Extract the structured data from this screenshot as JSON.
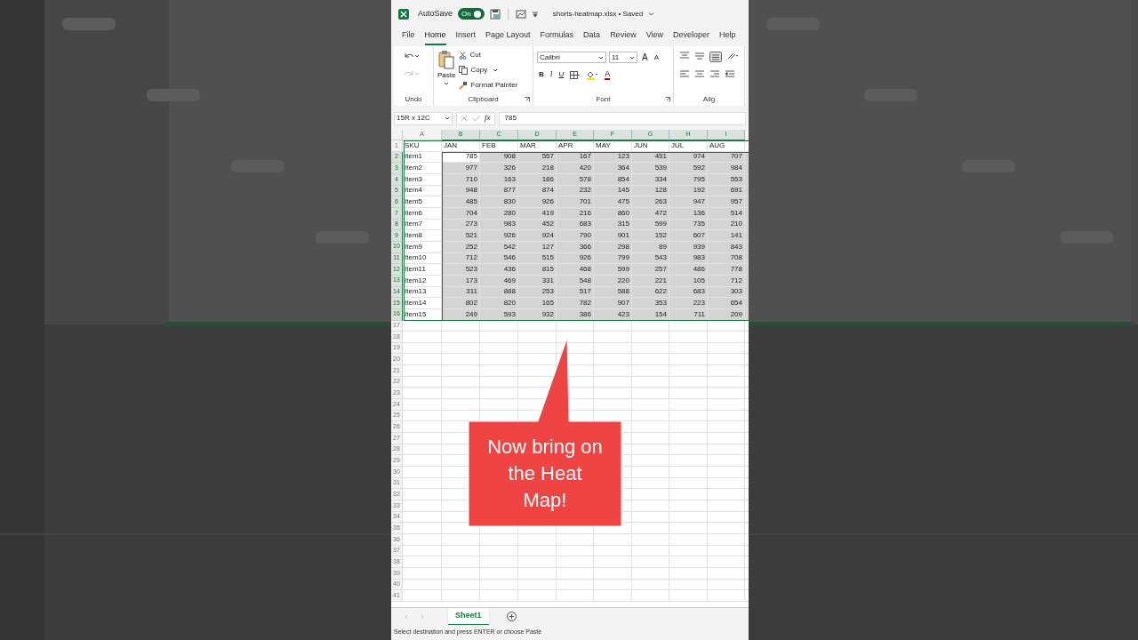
{
  "title_bar": {
    "autosave_label": "AutoSave",
    "autosave_toggle": {
      "label": "On",
      "on": true
    },
    "file_title": "shorts-heatmap.xlsx • Saved"
  },
  "tabs": [
    {
      "label": "File",
      "selected": false
    },
    {
      "label": "Home",
      "selected": true
    },
    {
      "label": "Insert",
      "selected": false
    },
    {
      "label": "Page Layout",
      "selected": false
    },
    {
      "label": "Formulas",
      "selected": false
    },
    {
      "label": "Data",
      "selected": false
    },
    {
      "label": "Review",
      "selected": false
    },
    {
      "label": "View",
      "selected": false
    },
    {
      "label": "Developer",
      "selected": false
    },
    {
      "label": "Help",
      "selected": false
    }
  ],
  "ribbon": {
    "undo": {
      "label": "Undo"
    },
    "clipboard": {
      "paste": "Paste",
      "cut": "Cut",
      "copy": "Copy",
      "format_painter": "Format Painter",
      "label": "Clipboard"
    },
    "font": {
      "font_name": "Calibri",
      "font_size": "11",
      "grow": "A",
      "shrink": "A",
      "bold": "B",
      "italic": "I",
      "underline": "U",
      "font_color": "A",
      "label": "Font"
    },
    "alignment": {
      "label": "Alig"
    }
  },
  "formula_bar": {
    "name_box": "15R x 12C",
    "fx": "fx",
    "value": "785"
  },
  "sheet": {
    "column_letters": [
      "A",
      "B",
      "C",
      "D",
      "E",
      "F",
      "G",
      "H",
      "I"
    ],
    "header": [
      "SKU",
      "JAN",
      "FEB",
      "MAR",
      "APR",
      "MAY",
      "JUN",
      "JUL",
      "AUG"
    ],
    "rows": [
      {
        "sku": "Item1",
        "selected": true,
        "active": true,
        "values": [
          "785",
          "908",
          "557",
          "167",
          "123",
          "451",
          "974",
          "707"
        ]
      },
      {
        "sku": "Item2",
        "selected": true,
        "active": false,
        "values": [
          "977",
          "326",
          "218",
          "420",
          "364",
          "539",
          "592",
          "984"
        ]
      },
      {
        "sku": "Item3",
        "selected": true,
        "active": false,
        "values": [
          "710",
          "163",
          "186",
          "578",
          "854",
          "334",
          "795",
          "553"
        ]
      },
      {
        "sku": "Item4",
        "selected": true,
        "active": false,
        "values": [
          "948",
          "877",
          "874",
          "232",
          "145",
          "128",
          "192",
          "691"
        ]
      },
      {
        "sku": "Item5",
        "selected": true,
        "active": false,
        "values": [
          "485",
          "830",
          "926",
          "701",
          "475",
          "263",
          "947",
          "957"
        ]
      },
      {
        "sku": "Item6",
        "selected": true,
        "active": false,
        "values": [
          "704",
          "280",
          "419",
          "216",
          "860",
          "472",
          "136",
          "514"
        ]
      },
      {
        "sku": "Item7",
        "selected": true,
        "active": false,
        "values": [
          "273",
          "983",
          "452",
          "683",
          "315",
          "599",
          "735",
          "210"
        ]
      },
      {
        "sku": "Item8",
        "selected": true,
        "active": false,
        "values": [
          "521",
          "926",
          "924",
          "790",
          "901",
          "152",
          "607",
          "141"
        ]
      },
      {
        "sku": "Item9",
        "selected": true,
        "active": false,
        "values": [
          "252",
          "542",
          "127",
          "366",
          "298",
          "89",
          "939",
          "843"
        ]
      },
      {
        "sku": "Item10",
        "selected": true,
        "active": false,
        "values": [
          "712",
          "546",
          "515",
          "926",
          "799",
          "543",
          "983",
          "708"
        ]
      },
      {
        "sku": "Item11",
        "selected": true,
        "active": false,
        "values": [
          "523",
          "436",
          "815",
          "468",
          "599",
          "257",
          "486",
          "778"
        ]
      },
      {
        "sku": "Item12",
        "selected": true,
        "active": false,
        "values": [
          "173",
          "469",
          "331",
          "548",
          "220",
          "221",
          "105",
          "712"
        ]
      },
      {
        "sku": "Item13",
        "selected": true,
        "active": false,
        "values": [
          "311",
          "888",
          "253",
          "517",
          "588",
          "622",
          "683",
          "303"
        ]
      },
      {
        "sku": "Item14",
        "selected": true,
        "active": false,
        "values": [
          "802",
          "820",
          "165",
          "782",
          "907",
          "353",
          "223",
          "654"
        ]
      },
      {
        "sku": "Item15",
        "selected": true,
        "active": false,
        "values": [
          "249",
          "593",
          "932",
          "386",
          "423",
          "154",
          "711",
          "209"
        ]
      }
    ],
    "row_numbers": [
      "1",
      "2",
      "3",
      "4",
      "5",
      "6",
      "7",
      "8",
      "9",
      "10",
      "11",
      "12",
      "13",
      "14",
      "15",
      "16",
      "17",
      "18",
      "19",
      "20",
      "21",
      "22",
      "23",
      "24",
      "25",
      "26",
      "27",
      "28",
      "29",
      "30",
      "31",
      "32",
      "33",
      "34",
      "35",
      "36",
      "37",
      "38",
      "39",
      "40",
      "41"
    ]
  },
  "sheet_tabs": [
    {
      "label": "Sheet1",
      "selected": true
    }
  ],
  "status_bar": "Select destination and press ENTER or choose Paste",
  "callout": "Now bring on the Heat Map!"
}
